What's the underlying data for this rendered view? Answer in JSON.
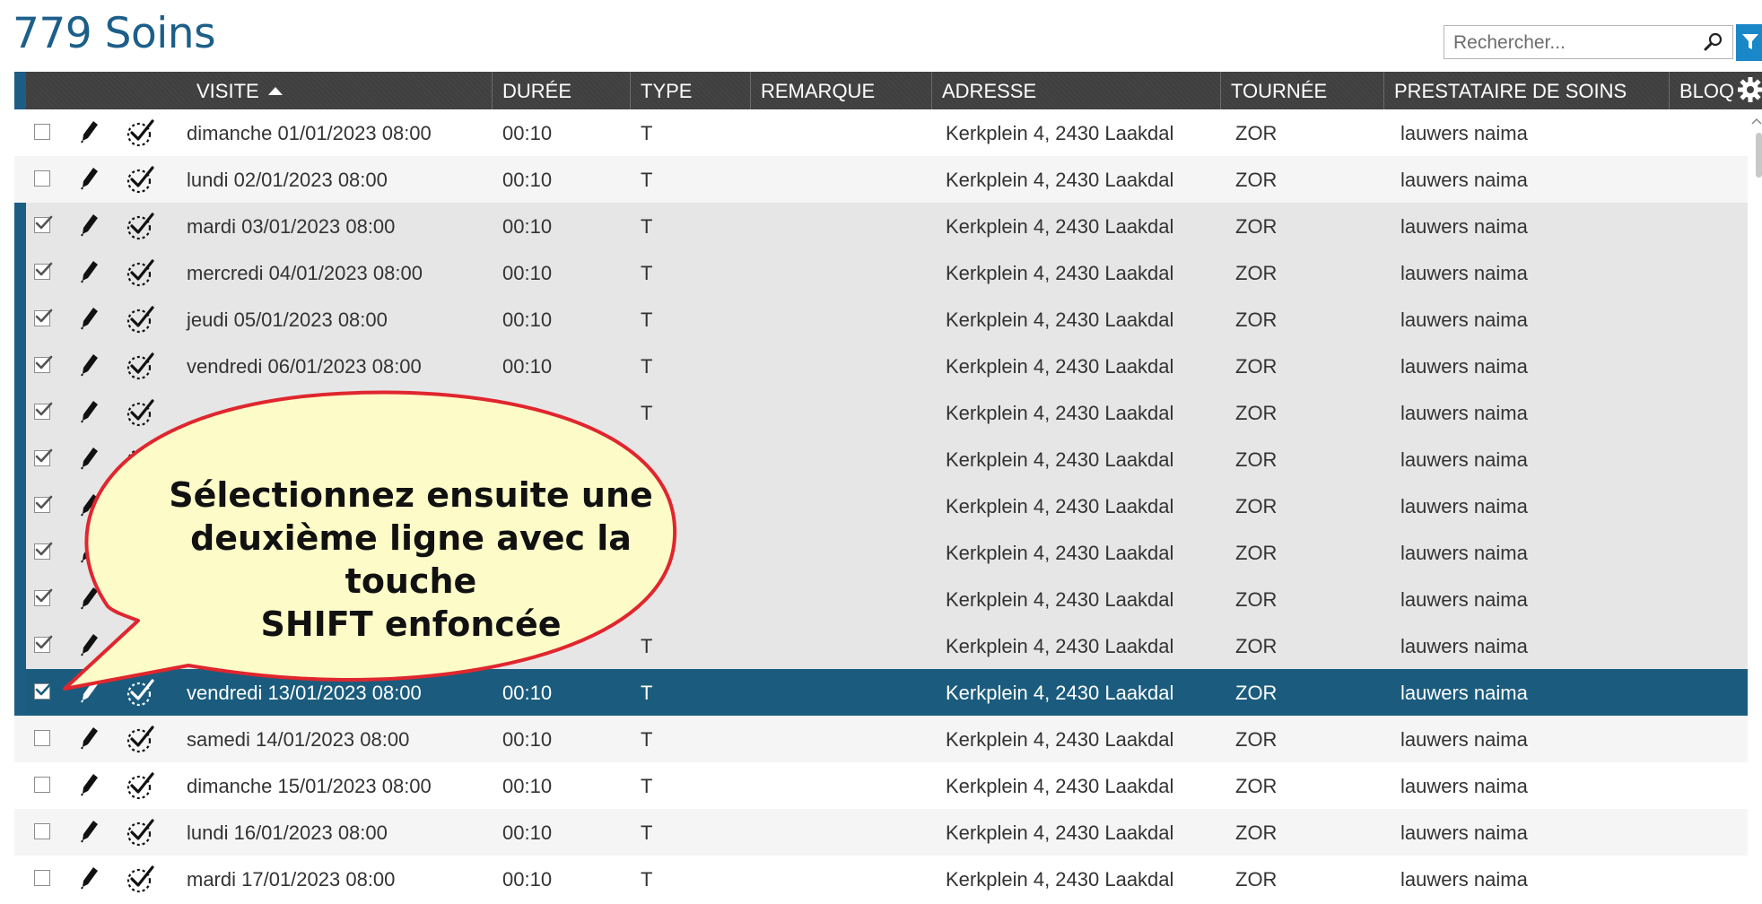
{
  "page": {
    "title": "779 Soins",
    "search_placeholder": "Rechercher..."
  },
  "columns": {
    "visite": "VISITE",
    "duree": "DURÉE",
    "type": "TYPE",
    "remarque": "REMARQUE",
    "adresse": "ADRESSE",
    "tournee": "TOURNÉE",
    "prestataire": "PRESTATAIRE DE SOINS",
    "bloq": "BLOQ"
  },
  "rows": [
    {
      "visite": "dimanche 01/01/2023 08:00",
      "duree": "00:10",
      "type": "T",
      "remarque": "",
      "adresse": "Kerkplein 4, 2430 Laakdal",
      "tournee": "ZOR",
      "prestataire": "lauwers naima",
      "state": "unselected"
    },
    {
      "visite": "lundi 02/01/2023 08:00",
      "duree": "00:10",
      "type": "T",
      "remarque": "",
      "adresse": "Kerkplein 4, 2430 Laakdal",
      "tournee": "ZOR",
      "prestataire": "lauwers naima",
      "state": "unselected"
    },
    {
      "visite": "mardi 03/01/2023 08:00",
      "duree": "00:10",
      "type": "T",
      "remarque": "",
      "adresse": "Kerkplein 4, 2430 Laakdal",
      "tournee": "ZOR",
      "prestataire": "lauwers naima",
      "state": "selected"
    },
    {
      "visite": "mercredi 04/01/2023 08:00",
      "duree": "00:10",
      "type": "T",
      "remarque": "",
      "adresse": "Kerkplein 4, 2430 Laakdal",
      "tournee": "ZOR",
      "prestataire": "lauwers naima",
      "state": "selected"
    },
    {
      "visite": "jeudi 05/01/2023 08:00",
      "duree": "00:10",
      "type": "T",
      "remarque": "",
      "adresse": "Kerkplein 4, 2430 Laakdal",
      "tournee": "ZOR",
      "prestataire": "lauwers naima",
      "state": "selected"
    },
    {
      "visite": "vendredi 06/01/2023 08:00",
      "duree": "00:10",
      "type": "T",
      "remarque": "",
      "adresse": "Kerkplein 4, 2430 Laakdal",
      "tournee": "ZOR",
      "prestataire": "lauwers naima",
      "state": "selected"
    },
    {
      "visite": "",
      "duree": "",
      "type": "T",
      "remarque": "",
      "adresse": "Kerkplein 4, 2430 Laakdal",
      "tournee": "ZOR",
      "prestataire": "lauwers naima",
      "state": "selected"
    },
    {
      "visite": "",
      "duree": "",
      "type": "",
      "remarque": "",
      "adresse": "Kerkplein 4, 2430 Laakdal",
      "tournee": "ZOR",
      "prestataire": "lauwers naima",
      "state": "selected"
    },
    {
      "visite": "",
      "duree": "",
      "type": "",
      "remarque": "",
      "adresse": "Kerkplein 4, 2430 Laakdal",
      "tournee": "ZOR",
      "prestataire": "lauwers naima",
      "state": "selected"
    },
    {
      "visite": "",
      "duree": "",
      "type": "",
      "remarque": "",
      "adresse": "Kerkplein 4, 2430 Laakdal",
      "tournee": "ZOR",
      "prestataire": "lauwers naima",
      "state": "selected"
    },
    {
      "visite": "",
      "duree": "",
      "type": "",
      "remarque": "",
      "adresse": "Kerkplein 4, 2430 Laakdal",
      "tournee": "ZOR",
      "prestataire": "lauwers naima",
      "state": "selected"
    },
    {
      "visite": "",
      "duree": "",
      "type": "T",
      "remarque": "",
      "adresse": "Kerkplein 4, 2430 Laakdal",
      "tournee": "ZOR",
      "prestataire": "lauwers naima",
      "state": "selected"
    },
    {
      "visite": "vendredi 13/01/2023 08:00",
      "duree": "00:10",
      "type": "T",
      "remarque": "",
      "adresse": "Kerkplein 4, 2430 Laakdal",
      "tournee": "ZOR",
      "prestataire": "lauwers naima",
      "state": "current"
    },
    {
      "visite": "samedi 14/01/2023 08:00",
      "duree": "00:10",
      "type": "T",
      "remarque": "",
      "adresse": "Kerkplein 4, 2430 Laakdal",
      "tournee": "ZOR",
      "prestataire": "lauwers naima",
      "state": "unselected"
    },
    {
      "visite": "dimanche 15/01/2023 08:00",
      "duree": "00:10",
      "type": "T",
      "remarque": "",
      "adresse": "Kerkplein 4, 2430 Laakdal",
      "tournee": "ZOR",
      "prestataire": "lauwers naima",
      "state": "unselected"
    },
    {
      "visite": "lundi 16/01/2023 08:00",
      "duree": "00:10",
      "type": "T",
      "remarque": "",
      "adresse": "Kerkplein 4, 2430 Laakdal",
      "tournee": "ZOR",
      "prestataire": "lauwers naima",
      "state": "unselected"
    },
    {
      "visite": "mardi 17/01/2023 08:00",
      "duree": "00:10",
      "type": "T",
      "remarque": "",
      "adresse": "Kerkplein 4, 2430 Laakdal",
      "tournee": "ZOR",
      "prestataire": "lauwers naima",
      "state": "unselected"
    }
  ],
  "callout": {
    "lines": [
      "Sélectionnez ensuite une",
      "deuxième ligne avec la touche",
      "SHIFT enfoncée"
    ]
  },
  "icons": {
    "search": "magnifier-icon",
    "filter": "funnel-icon",
    "settings": "gear-icon",
    "edit": "pencil-icon",
    "visit_done": "dashed-circle-check-icon"
  },
  "colors": {
    "title": "#1c5f8a",
    "header_bg": "#3f3f3f",
    "selection_bar": "#1d5d84",
    "current_row": "#1b5c7e",
    "selected_row": "#e6e6e6",
    "filter_button": "#1a87c8",
    "callout_fill": "#fdfcc8",
    "callout_stroke": "#e0262e"
  }
}
